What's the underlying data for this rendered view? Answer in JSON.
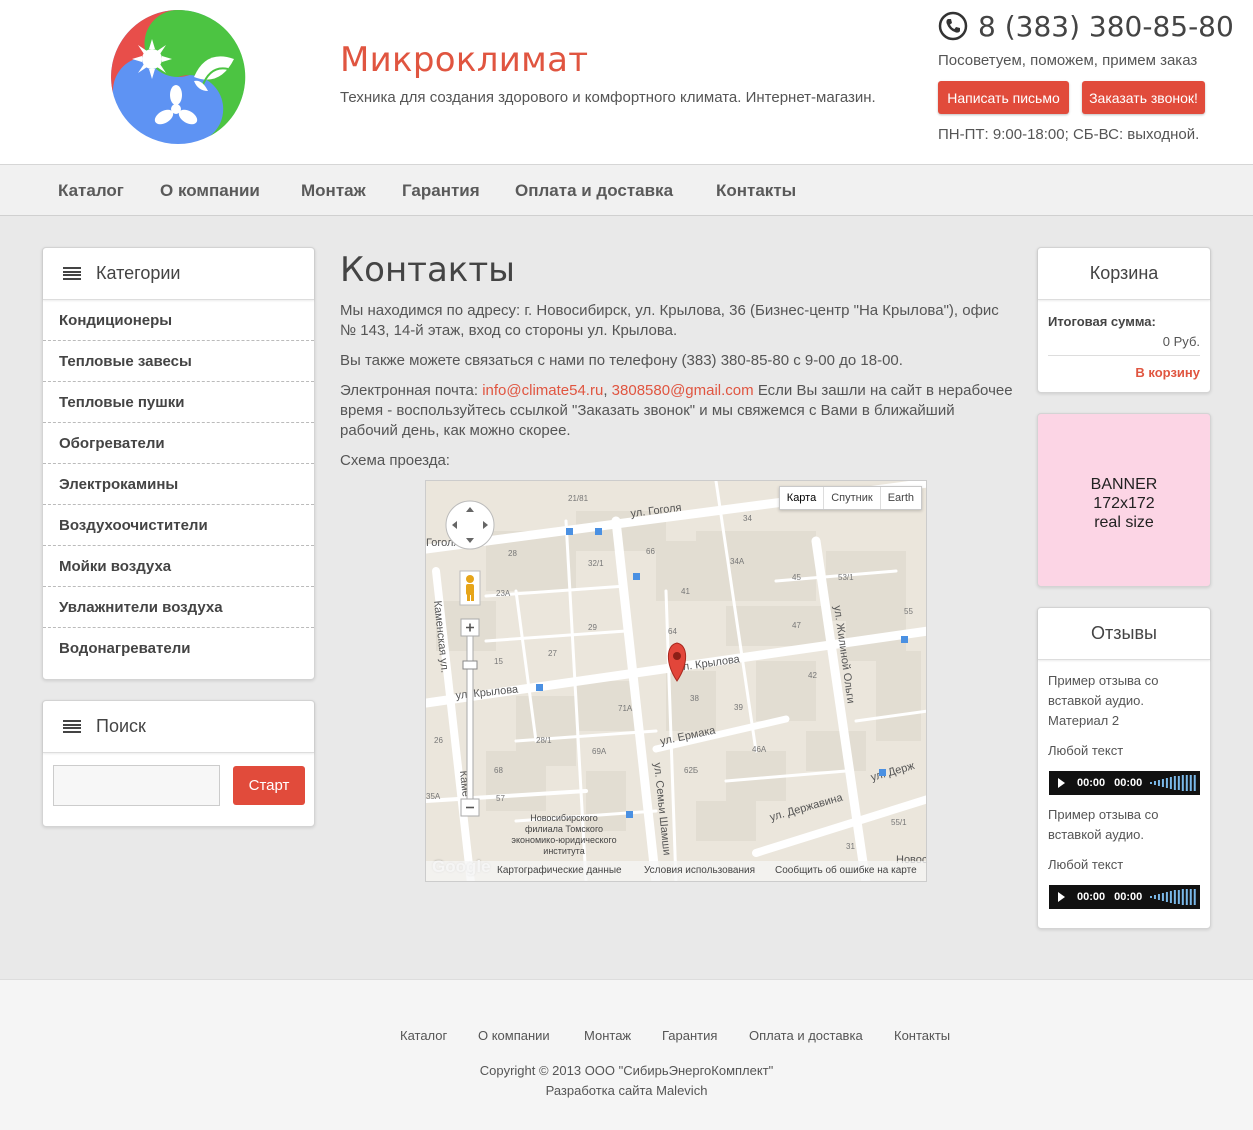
{
  "header": {
    "title": "Микроклимат",
    "description": "Техника для создания здорового и комфортного климата. Интернет-магазин.",
    "phone": "8 (383) 380-85-80",
    "note": "Посоветуем, поможем, примем заказ",
    "btn_letter": "Написать письмо",
    "btn_call": "Заказать звонок!",
    "hours": "ПН-ПТ: 9:00-18:00; СБ-ВС: выходной."
  },
  "nav": [
    "Каталог",
    "О компании",
    "Монтаж",
    "Гарантия",
    "Оплата и доставка",
    "Контакты"
  ],
  "categories": {
    "title": "Категории",
    "items": [
      "Кондиционеры",
      "Тепловые завесы",
      "Тепловые пушки",
      "Обогреватели",
      "Электрокамины",
      "Воздухоочистители",
      "Мойки воздуха",
      "Увлажнители воздуха",
      "Водонагреватели"
    ]
  },
  "search": {
    "title": "Поиск",
    "button": "Старт"
  },
  "main": {
    "title": "Контакты",
    "address": "Мы находимся по адресу: г. Новосибирск, ул. Крылова, 36 (Бизнес-центр \"На Крылова\"), офис № 143, 14-й этаж, вход со стороны ул. Крылова.",
    "phone_text": "Вы также можете связаться с нами по телефону (383) 380-85-80 с 9-00 до 18-00.",
    "email_prefix": "Электронная почта: ",
    "email1": "info@climate54.ru",
    "email_sep": ", ",
    "email2": "3808580@gmail.com",
    "email_suffix": " Если Вы зашли на сайт в нерабочее время - воспользуйтесь ссылкой \"Заказать звонок\" и мы свяжемся с Вами в ближайший рабочий день, как можно скорее.",
    "scheme": "Схема проезда:"
  },
  "map": {
    "types": [
      "Карта",
      "Спутник",
      "Earth"
    ],
    "streets": [
      "ул. Гоголя",
      "ул. Крылова",
      "ул. Крылова",
      "ул. Ермака",
      "ул. Державина",
      "ул. Держ",
      "ул. Жилиной Ольги",
      "ул. Семьи Шамши",
      "Каменская ул.",
      "Каме",
      "Гоголя",
      "Новос"
    ],
    "houses": [
      "21/81",
      "34",
      "28",
      "32/1",
      "66",
      "34А",
      "23А",
      "41",
      "45",
      "53/1",
      "29",
      "64",
      "47",
      "55",
      "15",
      "27",
      "42",
      "38",
      "39",
      "71А",
      "26",
      "28/1",
      "69А",
      "46А",
      "68",
      "62Б",
      "35А",
      "57",
      "55/1",
      "31"
    ],
    "institute": [
      "Новосибирского",
      "филиала Томского",
      "экономико-юридического",
      "института"
    ],
    "logo": "Google",
    "footer": [
      "Картографические данные",
      "Условия использования",
      "Сообщить об ошибке на карте"
    ]
  },
  "cart": {
    "title": "Корзина",
    "label": "Итоговая сумма:",
    "sum": "0 Руб.",
    "link": "В корзину"
  },
  "banner": {
    "line1": "BANNER",
    "line2": "172x172",
    "line3": "real size"
  },
  "reviews": {
    "title": "Отзывы",
    "review1": "Пример отзыва со вставкой аудио. Материал 2",
    "review1_extra": "Любой текст",
    "review2": "Пример отзыва со вставкой аудио.",
    "review2_extra": "Любой текст",
    "time": "00:00"
  },
  "footer": {
    "links": [
      "Каталог",
      "О компании",
      "Монтаж",
      "Гарантия",
      "Оплата и доставка",
      "Контакты"
    ],
    "copyright": "Copyright © 2013 ООО \"СибирьЭнергоКомплект\"",
    "dev": "Разработка сайта Malevich"
  },
  "colors": {
    "accent": "#e14b3b",
    "logo_red": "#e84e4a",
    "logo_green": "#4cc442",
    "logo_blue": "#5e93f3",
    "banner": "#fcd5e5"
  }
}
